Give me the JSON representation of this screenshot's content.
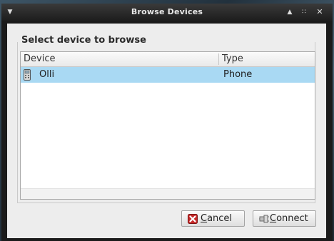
{
  "window": {
    "title": "Browse Devices"
  },
  "dialog": {
    "section_title": "Select device to browse",
    "columns": [
      "Device",
      "Type"
    ],
    "rows": [
      {
        "device": "Olli",
        "type": "Phone",
        "icon": "phone-icon",
        "selected": true
      }
    ]
  },
  "buttons": {
    "cancel": {
      "mnemonic": "C",
      "rest": "ancel",
      "icon": "cancel-x-icon"
    },
    "connect": {
      "mnemonic": "C",
      "rest": "onnect",
      "icon": "connect-plug-icon"
    }
  },
  "colors": {
    "selection": "#a9d9f3",
    "titlebar": "#1c1c1c"
  }
}
